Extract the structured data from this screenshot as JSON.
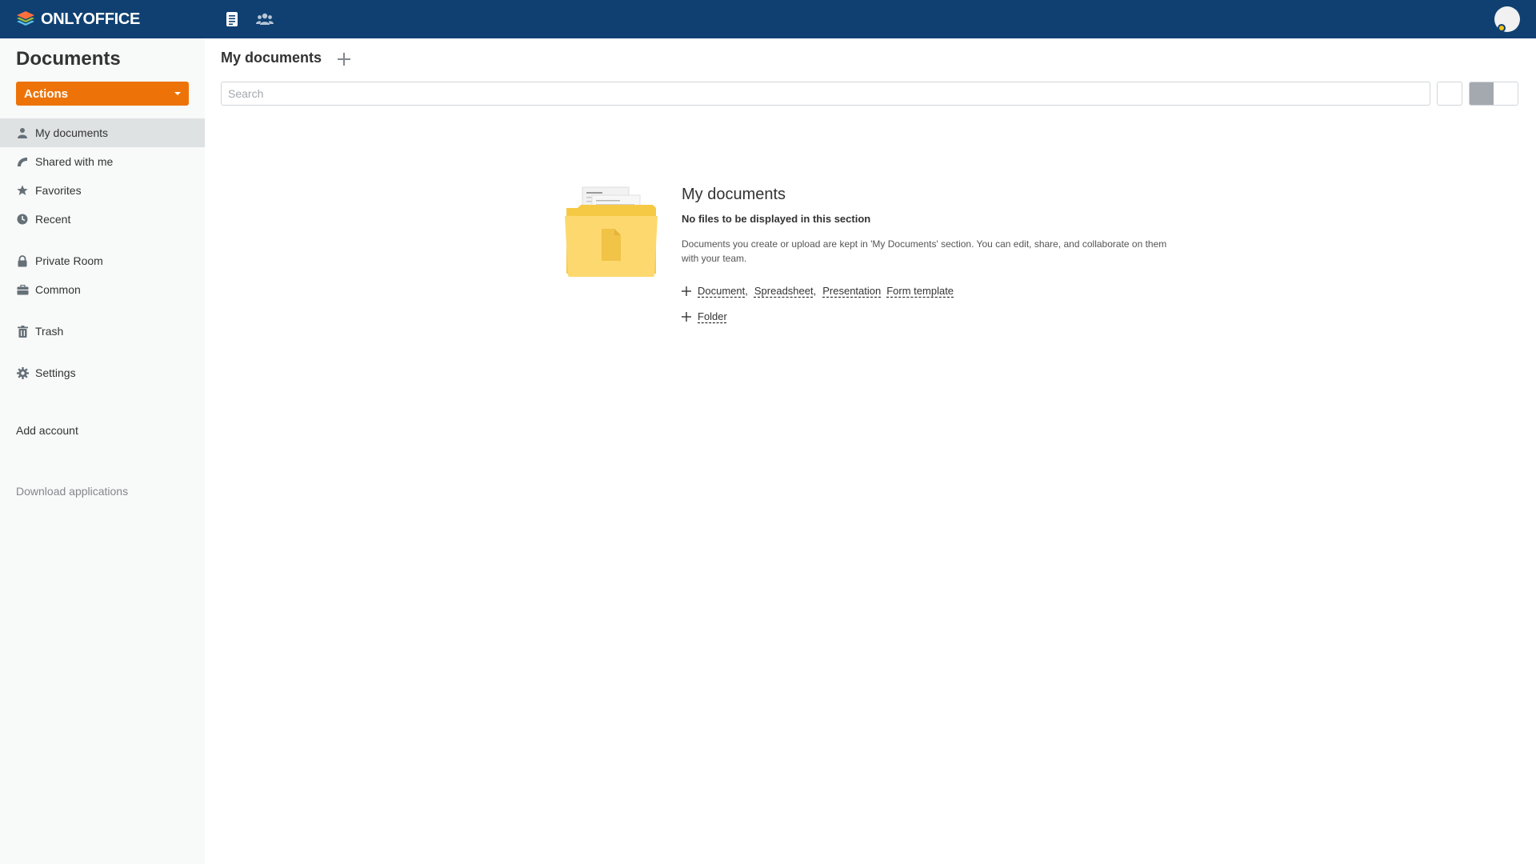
{
  "topbar": {
    "logo_text": "ONLYOFFICE",
    "documents_icon": "documents-icon",
    "people_icon": "people-icon",
    "avatar_icon": "avatar"
  },
  "sidebar": {
    "title": "Documents",
    "actions_label": "Actions",
    "items": [
      {
        "label": "My documents",
        "icon": "user-icon",
        "active": true
      },
      {
        "label": "Shared with me",
        "icon": "share-icon"
      },
      {
        "label": "Favorites",
        "icon": "star-icon"
      },
      {
        "label": "Recent",
        "icon": "clock-icon"
      },
      {
        "label": "Private Room",
        "icon": "lock-icon"
      },
      {
        "label": "Common",
        "icon": "briefcase-icon"
      },
      {
        "label": "Trash",
        "icon": "trash-icon"
      },
      {
        "label": "Settings",
        "icon": "gear-icon"
      }
    ],
    "add_account": "Add account",
    "download_apps": "Download applications"
  },
  "main": {
    "title": "My documents",
    "search_placeholder": "Search",
    "empty": {
      "heading": "My documents",
      "subheading": "No files to be displayed in this section",
      "description": "Documents you create or upload are kept in 'My Documents' section. You can edit, share, and collaborate on them with your team.",
      "create_links": [
        "Document",
        "Spreadsheet",
        "Presentation",
        "Form template"
      ],
      "folder_link": "Folder"
    }
  },
  "colors": {
    "topbar": "#0f4071",
    "actions": "#ed7309",
    "sidebar_bg": "#f8f9f9",
    "active_item": "#dfe2e3"
  }
}
